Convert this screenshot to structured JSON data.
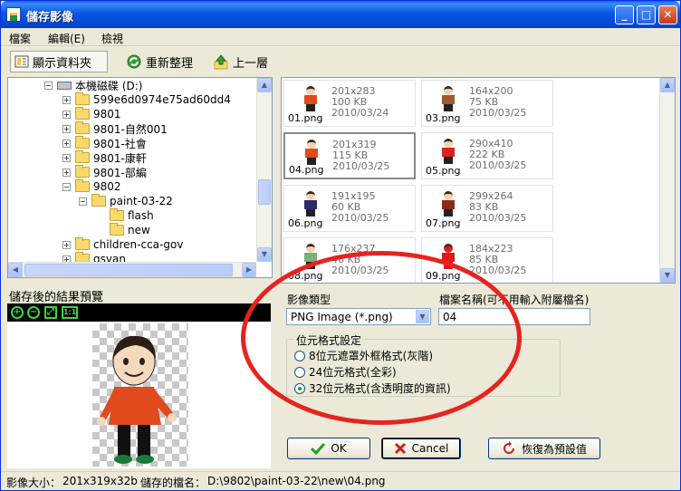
{
  "window": {
    "title": "儲存影像",
    "minimize_glyph": "_",
    "maximize_glyph": "□",
    "close_glyph": "✕"
  },
  "menu": {
    "items": [
      "檔案",
      "編輯(E)",
      "檢視"
    ]
  },
  "toolbar": {
    "show_folders": "顯示資料夾",
    "refresh": "重新整理",
    "up": "上一層"
  },
  "tree": {
    "items": [
      {
        "label": "本機磁碟 (D:)",
        "icon": "drive-icon",
        "expander": "−"
      },
      {
        "label": "599e6d0974e75ad60dd4",
        "icon": "folder-icon",
        "expander": "+"
      },
      {
        "label": "9801",
        "icon": "folder-icon",
        "expander": "+"
      },
      {
        "label": "9801-自然001",
        "icon": "folder-icon",
        "expander": "+"
      },
      {
        "label": "9801-社會",
        "icon": "folder-icon",
        "expander": "+"
      },
      {
        "label": "9801-康軒",
        "icon": "folder-icon",
        "expander": "+"
      },
      {
        "label": "9801-部編",
        "icon": "folder-icon",
        "expander": "+"
      },
      {
        "label": "9802",
        "icon": "folder-icon",
        "expander": "−"
      },
      {
        "label": "paint-03-22",
        "icon": "folder-open-icon",
        "expander": "−"
      },
      {
        "label": "flash",
        "icon": "folder-icon",
        "expander": ""
      },
      {
        "label": "new",
        "icon": "folder-open-icon",
        "expander": ""
      },
      {
        "label": "children-cca-gov",
        "icon": "folder-icon",
        "expander": "+"
      },
      {
        "label": "gsyan",
        "icon": "folder-icon",
        "expander": "+"
      }
    ]
  },
  "gallery": {
    "files": [
      {
        "name": "01.png",
        "dims": "201x283",
        "size": "100 KB",
        "date": "2010/03/24"
      },
      {
        "name": "03.png",
        "dims": "164x200",
        "size": "75 KB",
        "date": "2010/03/25"
      },
      {
        "name": "04.png",
        "dims": "201x319",
        "size": "115 KB",
        "date": "2010/03/25"
      },
      {
        "name": "05.png",
        "dims": "290x410",
        "size": "222 KB",
        "date": "2010/03/25"
      },
      {
        "name": "06.png",
        "dims": "191x195",
        "size": "60 KB",
        "date": "2010/03/25"
      },
      {
        "name": "07.png",
        "dims": "299x264",
        "size": "83 KB",
        "date": "2010/03/25"
      },
      {
        "name": "08.png",
        "dims": "176x237",
        "size": "46 KB",
        "date": "2010/03/25"
      },
      {
        "name": "09.png",
        "dims": "184x223",
        "size": "85 KB",
        "date": "2010/03/25"
      }
    ]
  },
  "preview": {
    "label": "儲存後的結果預覽",
    "zoom_in": "+",
    "zoom_out": "−",
    "fit": "⤢",
    "actual": "1:1"
  },
  "form": {
    "type_label": "影像類型",
    "type_value": "PNG Image (*.png)",
    "filename_label": "檔案名稱(可不用輸入附屬檔名)",
    "filename_value": "04",
    "bit_group_title": "位元格式設定",
    "options": [
      "8位元遮罩外框格式(灰階)",
      "24位元格式(全彩)",
      "32位元格式(含透明度的資訊)"
    ],
    "selected_option": 2
  },
  "buttons": {
    "ok": "OK",
    "cancel": "Cancel",
    "reset": "恢復為預設值"
  },
  "status": {
    "size_label": "影像大小：",
    "size_value": "201x319x32b",
    "path_label": "儲存的檔名：",
    "path_value": "D:\\9802\\paint-03-22\\new\\04.png"
  },
  "colors": {
    "title_bar": "#0558e5",
    "annotation": "#e7231d",
    "radio_dot": "#21a121",
    "ok_check": "#21a121",
    "cancel_x": "#c8201b"
  }
}
